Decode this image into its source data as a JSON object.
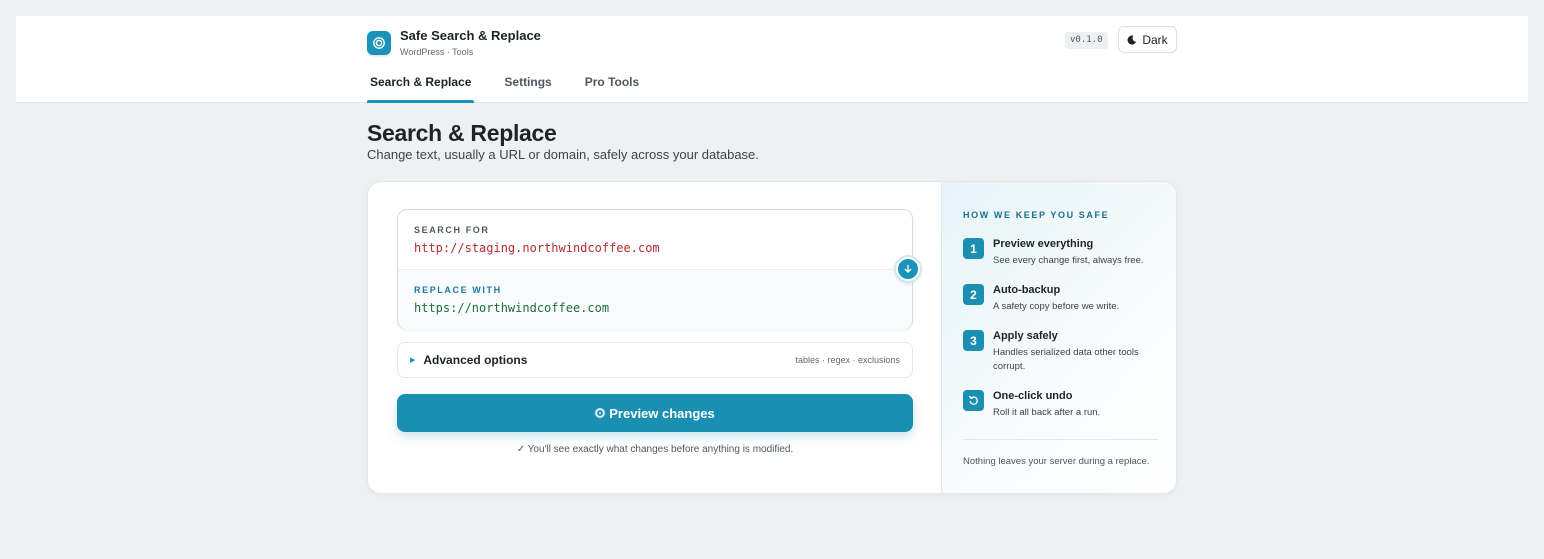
{
  "app": {
    "title": "Safe Search & Replace",
    "subtitle": "WordPress · Tools",
    "version": "v0.1.0",
    "theme_toggle_label": "Dark",
    "accent_color": "#1a93b8"
  },
  "tabs": [
    {
      "label": "Search & Replace",
      "active": true
    },
    {
      "label": "Settings",
      "active": false
    },
    {
      "label": "Pro Tools",
      "active": false
    }
  ],
  "page": {
    "title": "Search & Replace",
    "subtitle": "Change text, usually a URL or domain, safely across your database."
  },
  "form": {
    "search_label": "SEARCH FOR",
    "search_value": "http://staging.northwindcoffee.com",
    "replace_label": "REPLACE WITH",
    "replace_value": "https://northwindcoffee.com",
    "swap_icon": "arrow-down-icon"
  },
  "advanced": {
    "label": "Advanced options",
    "meta": "tables · regex · exclusions",
    "expanded": false
  },
  "preview": {
    "button_label": "Preview changes",
    "note": "✓ You'll see exactly what changes before anything is modified."
  },
  "safety": {
    "heading": "HOW WE KEEP YOU SAFE",
    "steps": [
      {
        "badge": "1",
        "title": "Preview everything",
        "desc": "See every change first, always free."
      },
      {
        "badge": "2",
        "title": "Auto-backup",
        "desc": "A safety copy before we write."
      },
      {
        "badge": "3",
        "title": "Apply safely",
        "desc": "Handles serialized data other tools corrupt."
      },
      {
        "badge": "undo-icon",
        "title": "One-click undo",
        "desc": "Roll it all back after a run."
      }
    ],
    "footer": "Nothing leaves your server during a replace."
  }
}
